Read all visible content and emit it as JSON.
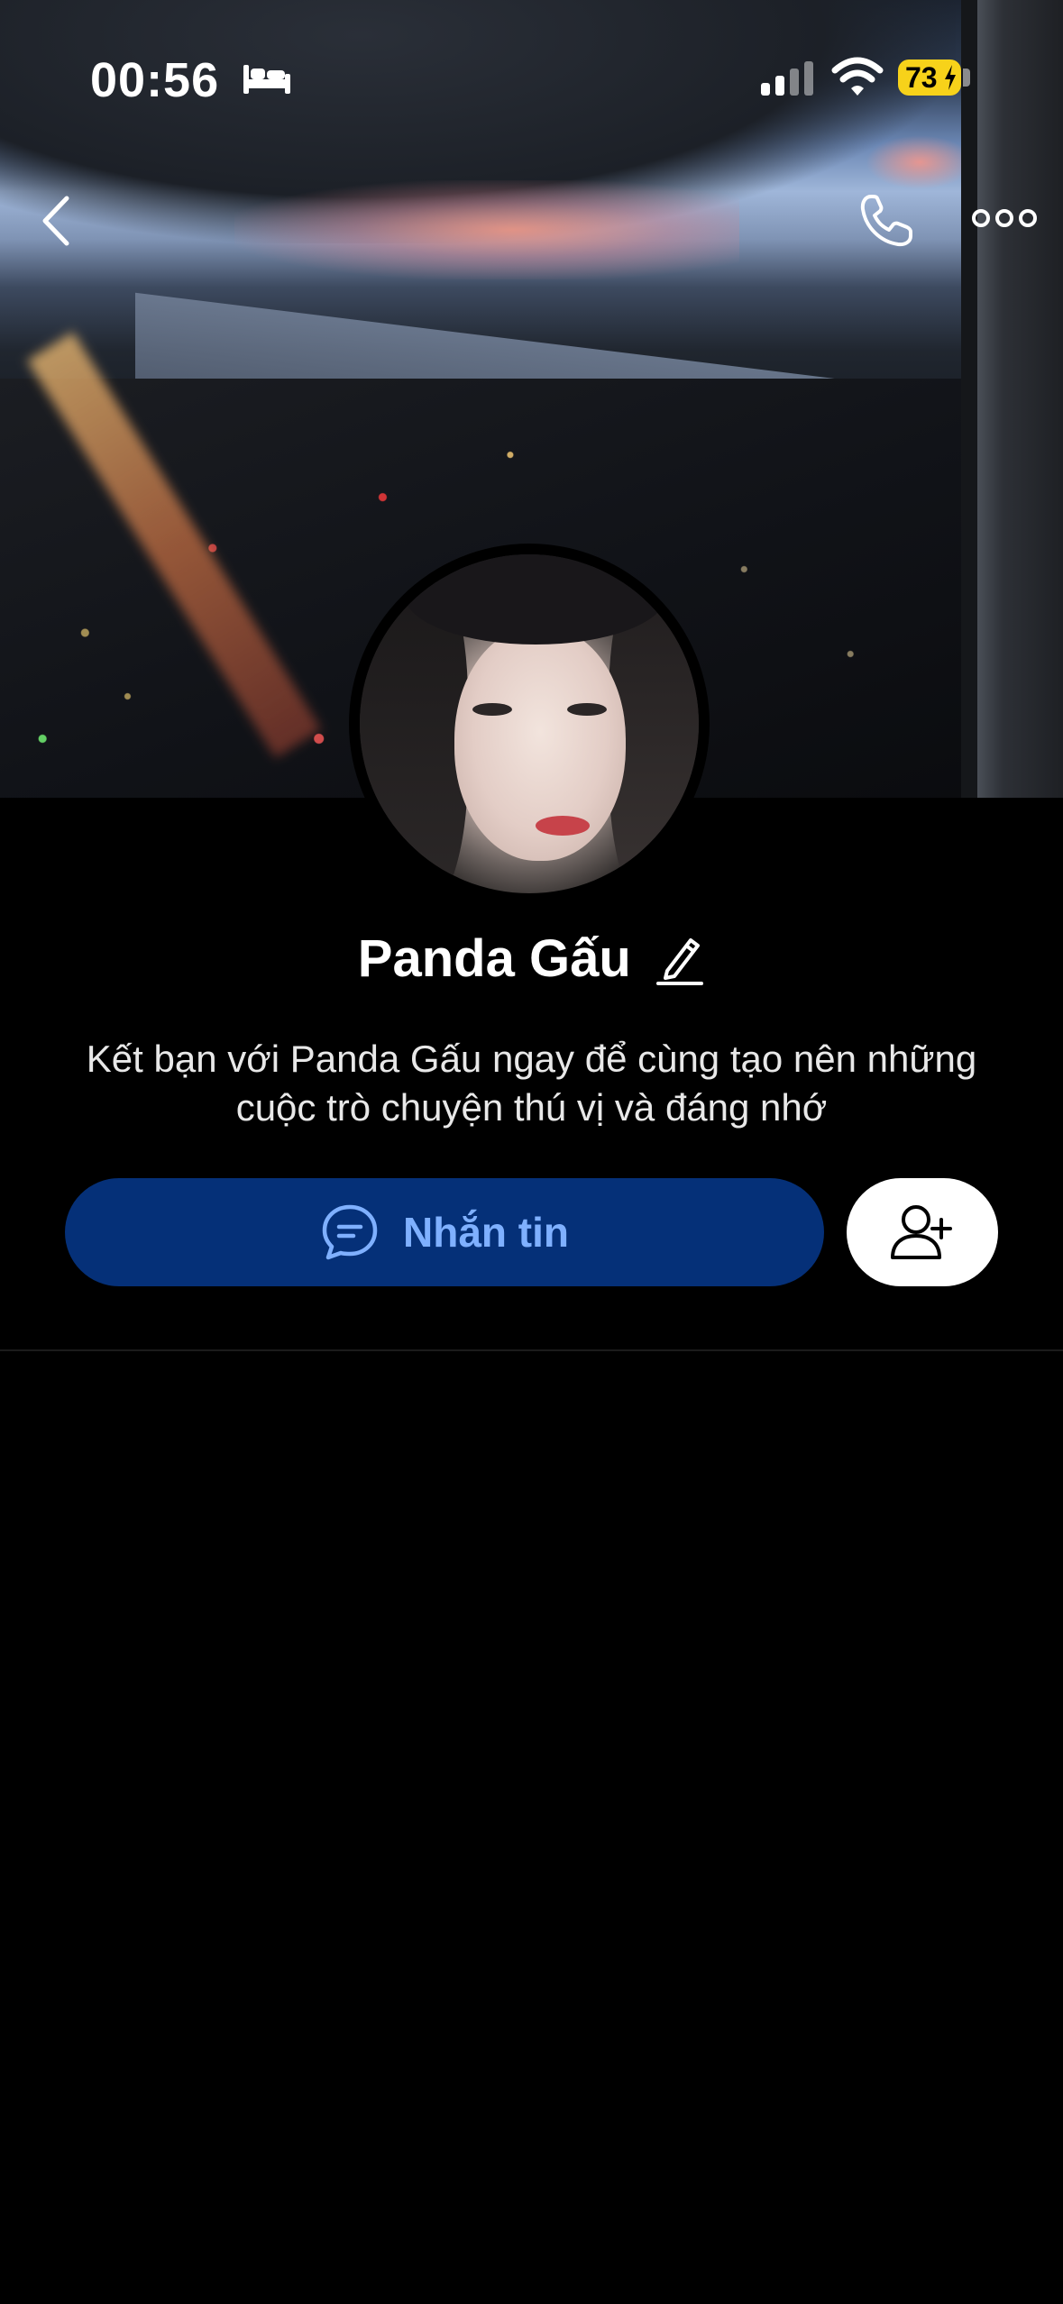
{
  "status_bar": {
    "time": "00:56",
    "battery": "73",
    "icons": [
      "bed-icon",
      "signal-icon",
      "wifi-icon",
      "battery-charging-icon"
    ]
  },
  "nav": {
    "icons": [
      "chevron-left-icon",
      "phone-icon",
      "more-dots-icon"
    ]
  },
  "profile": {
    "name": "Panda Gấu",
    "subtitle": "Kết bạn với Panda Gấu ngay để cùng tạo nên những cuộc trò chuyện thú vị và đáng nhớ"
  },
  "actions": {
    "message_label": "Nhắn tin",
    "add_friend_icon": "add-user-icon"
  },
  "colors": {
    "background": "#000000",
    "message_button": "#053078",
    "message_text": "#7fb0ff",
    "battery": "#f7d21a"
  }
}
